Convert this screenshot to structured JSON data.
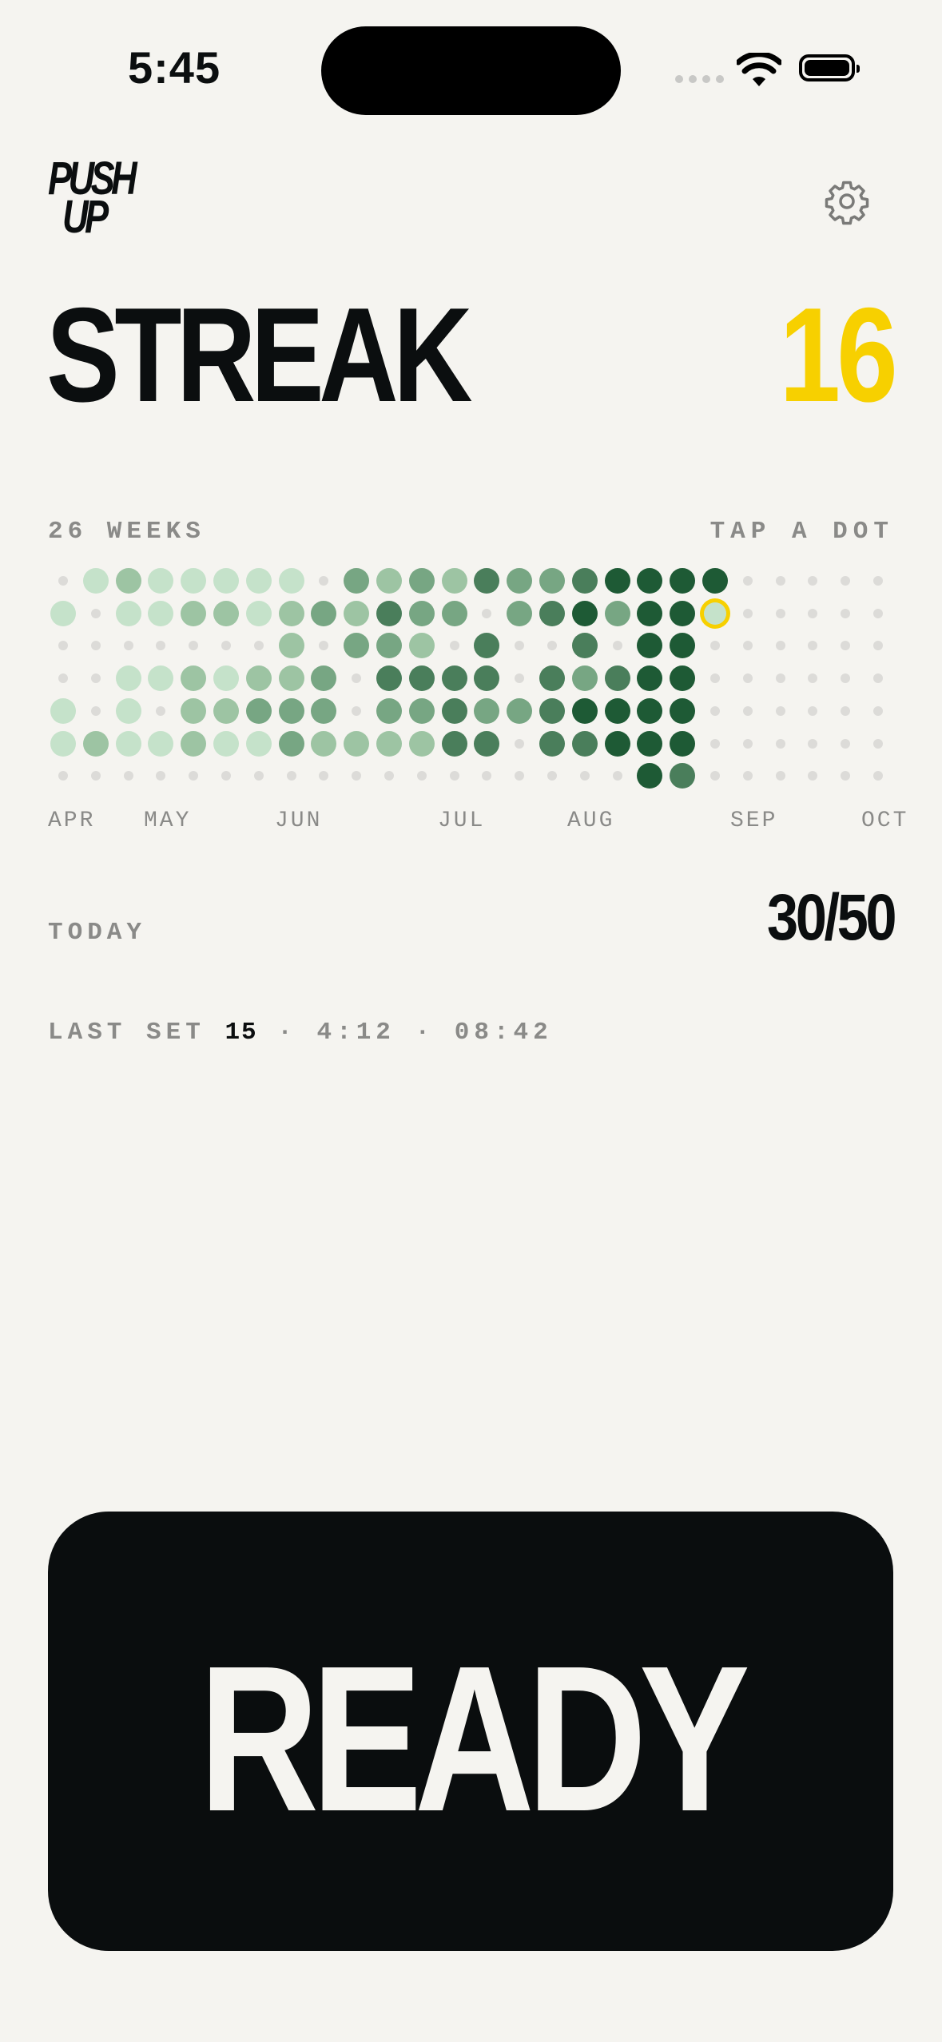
{
  "status_bar": {
    "time": "5:45"
  },
  "logo": {
    "line1": "PUSH",
    "line2": "UP"
  },
  "header": {
    "settings_icon": "gear-icon"
  },
  "streak": {
    "title": "STREAK",
    "count": "16",
    "count_color": "#f7d000"
  },
  "history": {
    "weeks_label": "26 WEEKS",
    "hint": "TAP A DOT",
    "months": [
      "APR",
      "MAY",
      "JUN",
      "JUL",
      "AUG",
      "SEP",
      "OCT"
    ],
    "level_colors": [
      "#dcdbd8",
      "#c5e2ca",
      "#9dc4a3",
      "#77a683",
      "#4a7e5b",
      "#1e5a35"
    ],
    "selected": {
      "week": 20,
      "day": 1
    },
    "levels_by_week": [
      [
        0,
        1,
        0,
        0,
        1,
        1,
        0
      ],
      [
        1,
        0,
        0,
        0,
        0,
        2,
        0
      ],
      [
        2,
        1,
        0,
        1,
        1,
        1,
        0
      ],
      [
        1,
        1,
        0,
        1,
        0,
        1,
        0
      ],
      [
        1,
        2,
        0,
        2,
        2,
        2,
        0
      ],
      [
        1,
        2,
        0,
        1,
        2,
        1,
        0
      ],
      [
        1,
        1,
        0,
        2,
        3,
        1,
        0
      ],
      [
        1,
        2,
        2,
        2,
        3,
        3,
        0
      ],
      [
        0,
        3,
        0,
        3,
        3,
        2,
        0
      ],
      [
        3,
        2,
        3,
        0,
        0,
        2,
        0
      ],
      [
        2,
        4,
        3,
        4,
        3,
        2,
        0
      ],
      [
        3,
        3,
        2,
        4,
        3,
        2,
        0
      ],
      [
        2,
        3,
        0,
        4,
        4,
        4,
        0
      ],
      [
        4,
        0,
        4,
        4,
        3,
        4,
        0
      ],
      [
        3,
        3,
        0,
        0,
        3,
        0,
        0
      ],
      [
        3,
        4,
        0,
        4,
        4,
        4,
        0
      ],
      [
        4,
        5,
        4,
        3,
        5,
        4,
        0
      ],
      [
        5,
        3,
        0,
        4,
        5,
        5,
        0
      ],
      [
        5,
        5,
        5,
        5,
        5,
        5,
        5
      ],
      [
        5,
        5,
        5,
        5,
        5,
        5,
        4
      ],
      [
        5,
        1,
        0,
        0,
        0,
        0,
        0
      ],
      [
        0,
        0,
        0,
        0,
        0,
        0,
        0
      ],
      [
        0,
        0,
        0,
        0,
        0,
        0,
        0
      ],
      [
        0,
        0,
        0,
        0,
        0,
        0,
        0
      ],
      [
        0,
        0,
        0,
        0,
        0,
        0,
        0
      ],
      [
        0,
        0,
        0,
        0,
        0,
        0,
        0
      ]
    ]
  },
  "today": {
    "label": "TODAY",
    "value": "30/50"
  },
  "last_set": {
    "label": "LAST SET",
    "count": "15",
    "duration": "4:12",
    "time": "08:42",
    "separator": "·"
  },
  "ready_button": {
    "label": "READY"
  }
}
